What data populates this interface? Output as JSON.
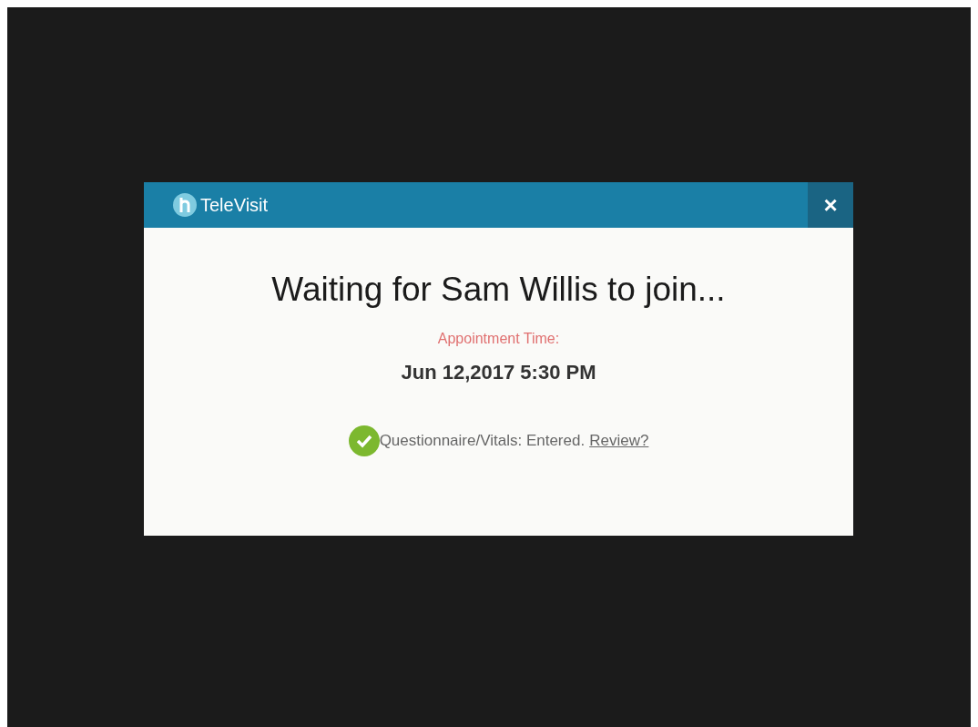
{
  "dialog": {
    "title": "TeleVisit",
    "close": "×",
    "heading": "Waiting for Sam Willis to join...",
    "appointment_label": "Appointment Time:",
    "appointment_time": "Jun 12,2017 5:30 PM",
    "status": {
      "complete": true,
      "text": "Questionnaire/Vitals: Entered.",
      "link": "Review?"
    }
  }
}
